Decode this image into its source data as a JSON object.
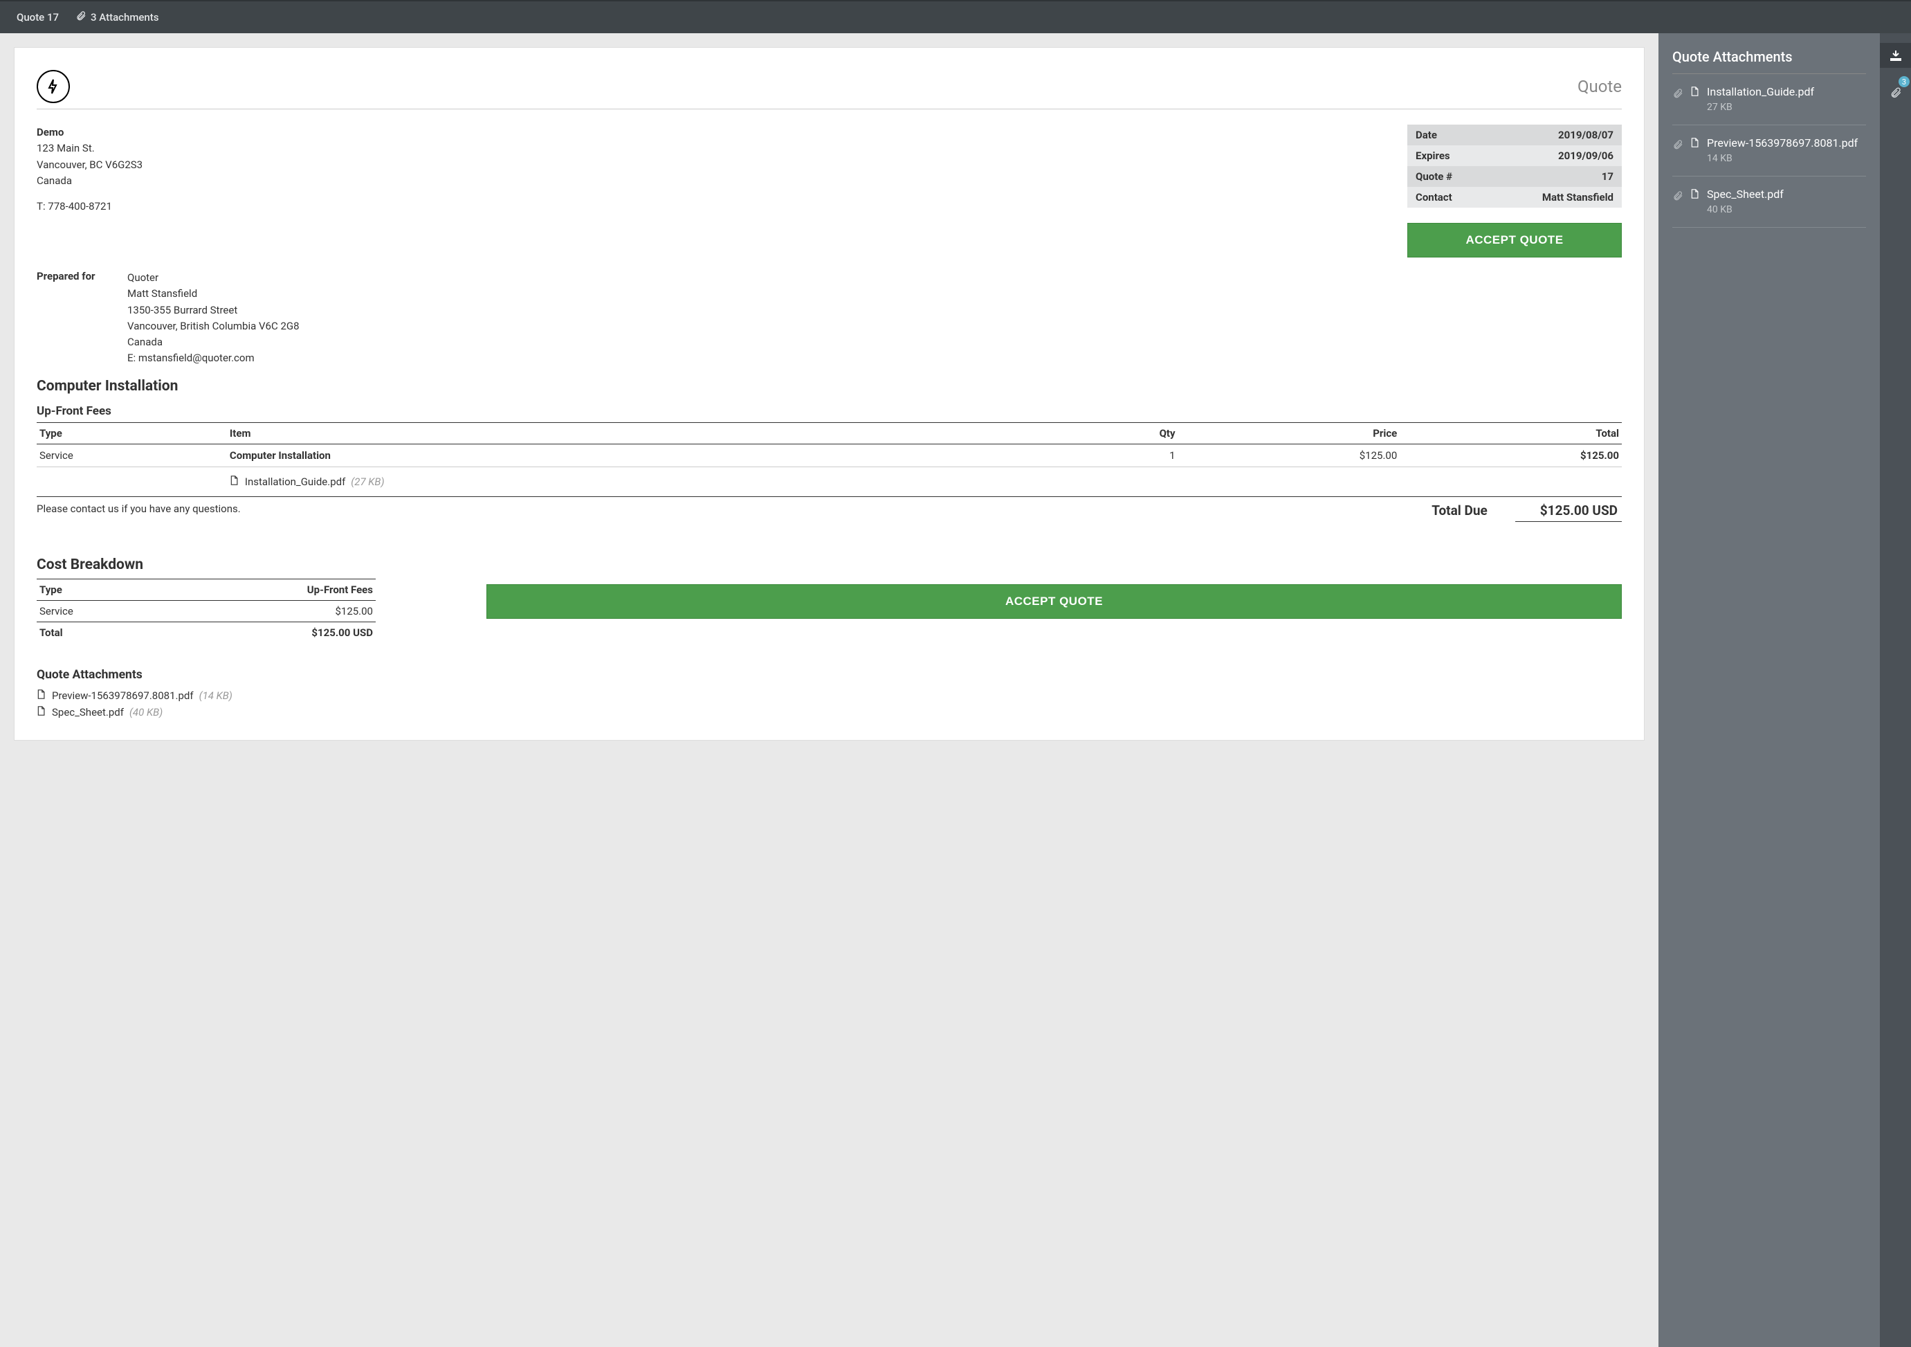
{
  "topbar": {
    "title": "Quote 17",
    "attachments_label": "3 Attachments"
  },
  "doc_label": "Quote",
  "from": {
    "name": "Demo",
    "line1": "123 Main St.",
    "line2": "Vancouver, BC V6G2S3",
    "line3": "Canada",
    "phone": "T: 778-400-8721"
  },
  "meta": {
    "date_label": "Date",
    "date": "2019/08/07",
    "expires_label": "Expires",
    "expires": "2019/09/06",
    "quoteno_label": "Quote #",
    "quoteno": "17",
    "contact_label": "Contact",
    "contact": "Matt Stansfield"
  },
  "accept_label": "ACCEPT QUOTE",
  "prepared": {
    "label": "Prepared for",
    "company": "Quoter",
    "name": "Matt Stansfield",
    "line1": "1350-355 Burrard Street",
    "line2": "Vancouver, British Columbia V6C 2G8",
    "line3": "Canada",
    "email": "E: mstansfield@quoter.com"
  },
  "section_title": "Computer Installation",
  "upfront_label": "Up-Front Fees",
  "items_headers": {
    "type": "Type",
    "item": "Item",
    "qty": "Qty",
    "price": "Price",
    "total": "Total"
  },
  "items": [
    {
      "type": "Service",
      "item": "Computer Installation",
      "qty": "1",
      "price": "$125.00",
      "total": "$125.00",
      "attachment": {
        "name": "Installation_Guide.pdf",
        "size": "(27 KB)"
      }
    }
  ],
  "contact_note": "Please contact us if you have any questions.",
  "total_due_label": "Total Due",
  "total_due_value": "$125.00 USD",
  "cost": {
    "title": "Cost Breakdown",
    "headers": {
      "type": "Type",
      "fees": "Up-Front Fees"
    },
    "rows": [
      {
        "type": "Service",
        "value": "$125.00"
      }
    ],
    "total_label": "Total",
    "total_value": "$125.00 USD"
  },
  "doc_attachments": {
    "title": "Quote Attachments",
    "items": [
      {
        "name": "Preview-1563978697.8081.pdf",
        "size": "(14 KB)"
      },
      {
        "name": "Spec_Sheet.pdf",
        "size": "(40 KB)"
      }
    ]
  },
  "sidebar": {
    "title": "Quote Attachments",
    "items": [
      {
        "name": "Installation_Guide.pdf",
        "size": "27 KB"
      },
      {
        "name": "Preview-1563978697.8081.pdf",
        "size": "14 KB"
      },
      {
        "name": "Spec_Sheet.pdf",
        "size": "40 KB"
      }
    ],
    "badge": "3"
  }
}
